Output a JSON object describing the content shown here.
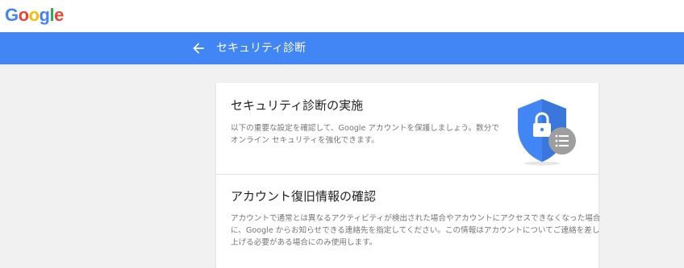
{
  "logo": {
    "letters": [
      "G",
      "o",
      "o",
      "g",
      "l",
      "e"
    ],
    "colors": [
      "#4285f4",
      "#ea4335",
      "#fbbc05",
      "#4285f4",
      "#34a853",
      "#ea4335"
    ]
  },
  "header": {
    "title": "セキュリティ診断",
    "back_icon": "arrow-left-icon",
    "bar_color": "#4285f4"
  },
  "sections": [
    {
      "title": "セキュリティ診断の実施",
      "body_lines": [
        "以下の重要な設定を確認して、Google アカウントを保護しましょう。数分で",
        "オンライン セキュリティを強化できます。"
      ],
      "icon": "shield-lock-icon"
    },
    {
      "title": "アカウント復旧情報の確認",
      "body_lines": [
        "アカウントで通常とは異なるアクティビティが検出された場合やアカウントにアクセスできなくなった場合",
        "に、Google からお知らせできる連絡先を指定してください。この情報はアカウントについてご連絡を差し",
        "上げる必要がある場合にのみ使用します。"
      ]
    }
  ]
}
